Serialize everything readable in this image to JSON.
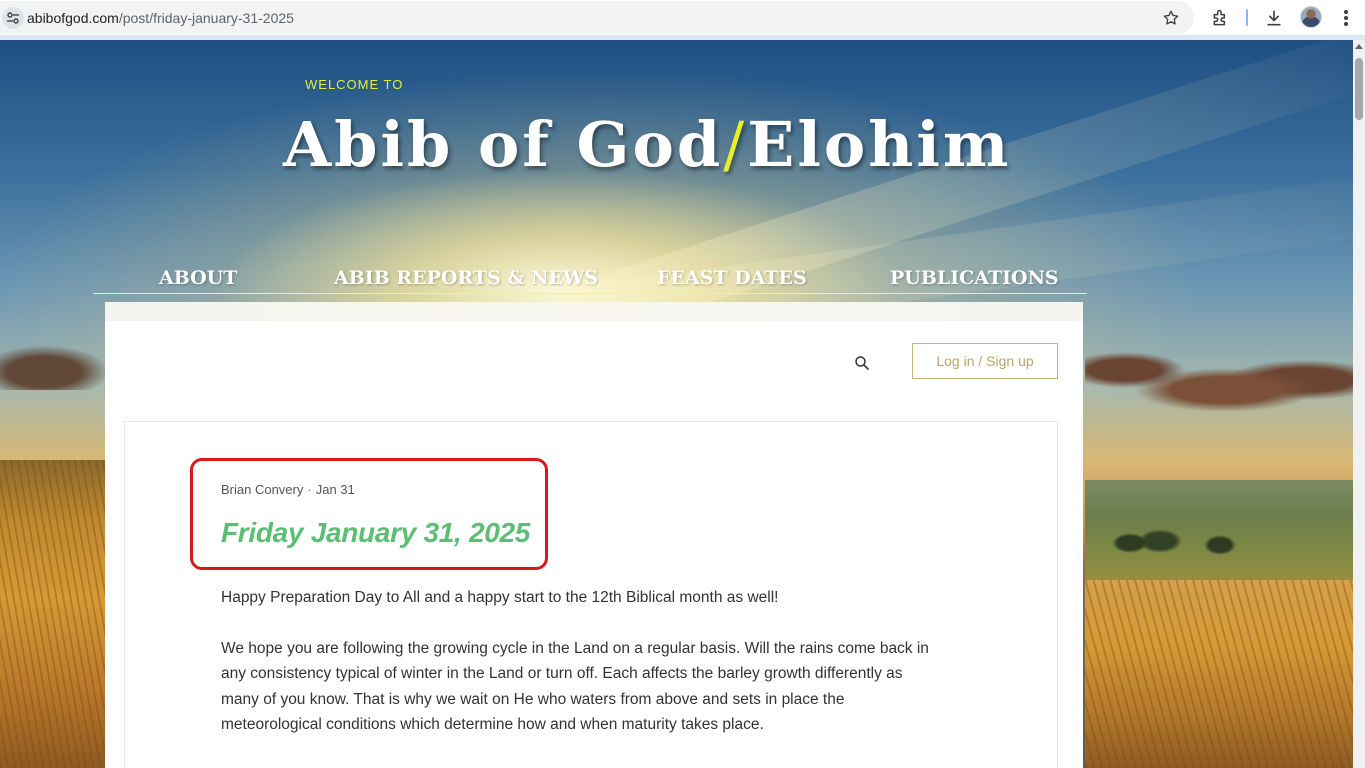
{
  "browser": {
    "url_domain": "abibofgod.com",
    "url_path": "/post/friday-january-31-2025",
    "icons": [
      "site-info-icon",
      "star-icon",
      "extensions-icon",
      "download-icon",
      "profile-avatar",
      "menu-icon"
    ]
  },
  "header": {
    "welcome": "WELCOME TO",
    "title_part1": "Abib of God",
    "title_slash": "/",
    "title_part2": "Elohim",
    "accent_color": "#e9ee2c"
  },
  "nav": {
    "items": [
      {
        "label": "ABOUT"
      },
      {
        "label": "ABIB REPORTS & NEWS"
      },
      {
        "label": "FEAST DATES"
      },
      {
        "label": "PUBLICATIONS"
      }
    ]
  },
  "toolbar": {
    "search_icon": "search-icon",
    "login_label": "Log in / Sign up"
  },
  "post": {
    "author": "Brian Convery",
    "separator": "·",
    "date": "Jan 31",
    "title": "Friday January 31, 2025",
    "title_color": "#5bbf73",
    "paragraphs": [
      "Happy Preparation Day to All and a happy start to the 12th Biblical month as well!",
      "We hope you are following the growing cycle in the Land on a regular basis. Will the rains come back in any consistency typical of winter in the Land or turn off. Each affects the barley growth differently as many of you know. That is why we wait on He who waters from above and sets in place the meteorological conditions which determine how and when maturity takes place."
    ]
  }
}
